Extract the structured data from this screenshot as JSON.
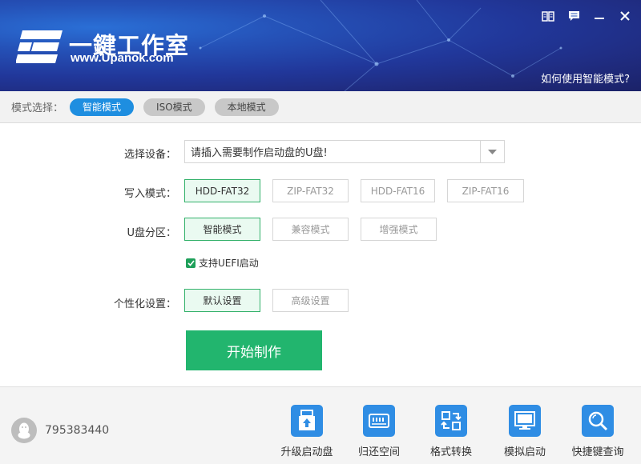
{
  "header": {
    "brand_name": "一鍵工作室",
    "brand_url": "www.Upanok.com",
    "help_link": "如何使用智能模式?",
    "window_buttons": [
      "book-icon",
      "message-icon",
      "minimize-icon",
      "close-icon"
    ]
  },
  "modebar": {
    "label": "模式选择：",
    "modes": [
      {
        "label": "智能模式",
        "active": true
      },
      {
        "label": "ISO模式",
        "active": false
      },
      {
        "label": "本地模式",
        "active": false
      }
    ]
  },
  "device": {
    "label": "选择设备：",
    "value": "请插入需要制作启动盘的U盘!"
  },
  "write_mode": {
    "label": "写入模式：",
    "options": [
      {
        "label": "HDD-FAT32",
        "selected": true
      },
      {
        "label": "ZIP-FAT32",
        "selected": false
      },
      {
        "label": "HDD-FAT16",
        "selected": false
      },
      {
        "label": "ZIP-FAT16",
        "selected": false
      }
    ]
  },
  "partition": {
    "label": "U盘分区：",
    "options": [
      {
        "label": "智能模式",
        "selected": true
      },
      {
        "label": "兼容模式",
        "selected": false
      },
      {
        "label": "增强模式",
        "selected": false
      }
    ],
    "uefi_label": "支持UEFI启动",
    "uefi_checked": true
  },
  "personal": {
    "label": "个性化设置：",
    "options": [
      {
        "label": "默认设置",
        "selected": true
      },
      {
        "label": "高级设置",
        "selected": false
      }
    ]
  },
  "start_button": "开始制作",
  "footer": {
    "qq_number": "795383440",
    "tools": [
      {
        "label": "升级启动盘",
        "icon": "upgrade-icon"
      },
      {
        "label": "归还空间",
        "icon": "disk-icon"
      },
      {
        "label": "格式转换",
        "icon": "convert-icon"
      },
      {
        "label": "模拟启动",
        "icon": "monitor-icon"
      },
      {
        "label": "快捷键查询",
        "icon": "search-icon"
      }
    ]
  },
  "colors": {
    "accent_blue": "#1e8ee0",
    "accent_green": "#22b56e",
    "header_dark": "#1f2a7c"
  }
}
